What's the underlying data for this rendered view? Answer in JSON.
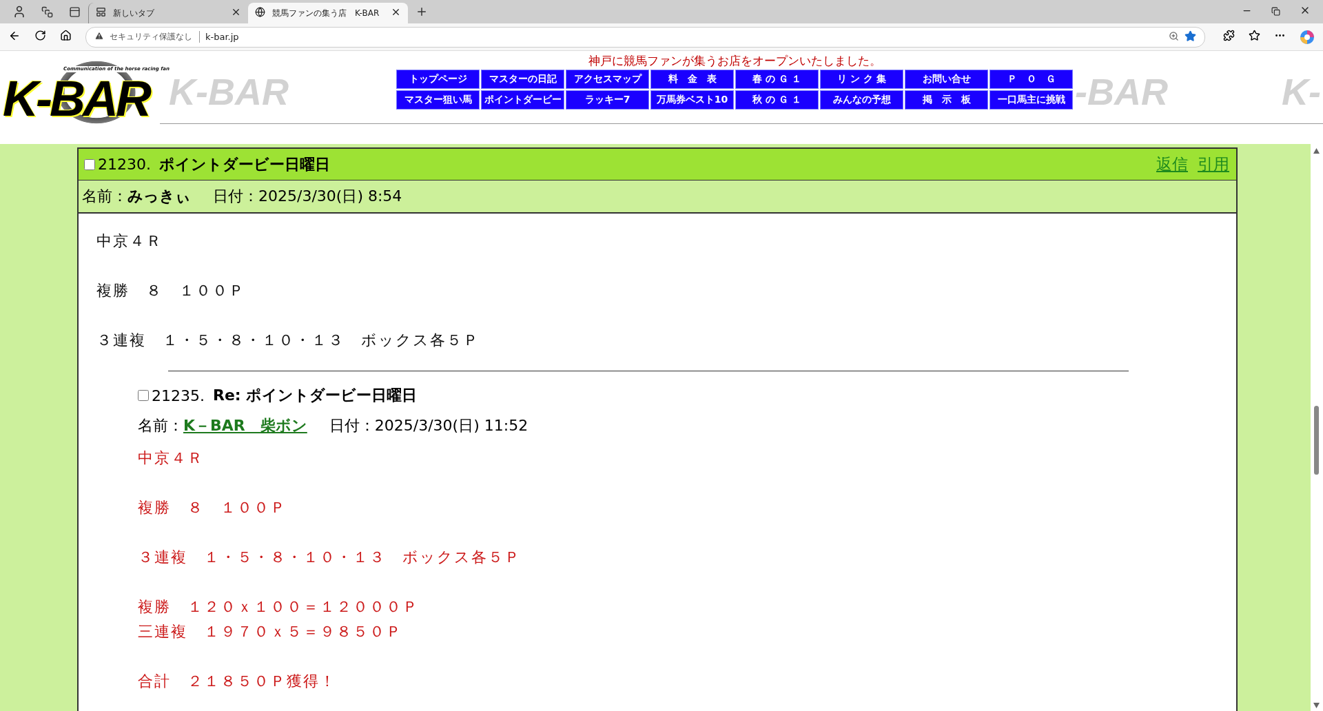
{
  "browser": {
    "tabs": [
      {
        "title": "新しいタブ",
        "selected": false
      },
      {
        "title": "競馬ファンの集う店　K-BAR",
        "selected": true
      }
    ],
    "address": {
      "security": "セキュリティ保護なし",
      "url": "k-bar.jp"
    }
  },
  "header": {
    "logo": {
      "title": "K-BAR",
      "tagline": "Communication of the horse racing fan"
    },
    "background_logos": [
      "K-BAR",
      "-BAR",
      "K-"
    ],
    "announcement": "神戸に競馬ファンが集うお店をオープンいたしました。",
    "nav": [
      [
        "トップページ",
        "マスターの日記",
        "アクセスマップ",
        "料　金　表",
        "春 の Ｇ １",
        "リ ン ク 集",
        "お問い合せ",
        "Ｐ　Ｏ　Ｇ"
      ],
      [
        "マスター狙い馬",
        "ポイントダービー",
        "ラッキー7",
        "万馬券ベスト10",
        "秋 の Ｇ １",
        "みんなの予想",
        "掲　示　板",
        "一口馬主に挑戦"
      ]
    ]
  },
  "post": {
    "checked": false,
    "number": "21230.",
    "title": "ポイントダービー日曜日",
    "actions": [
      "返信",
      "引用"
    ],
    "name_label": "名前：",
    "author": "みっきぃ",
    "date_label": "日付：",
    "date": "2025/3/30(日) 8:54",
    "paragraphs": [
      [
        "中京４Ｒ"
      ],
      [
        "複勝　８　１００Ｐ"
      ],
      [
        "３連複　１・５・８・１０・１３　ボックス各５Ｐ"
      ]
    ],
    "reply": {
      "checked": false,
      "number": "21235.",
      "title": "Re: ポイントダービー日曜日",
      "name_label": "名前：",
      "author_link": "K－BAR　柴ボン",
      "date_label": "日付：",
      "date": "2025/3/30(日) 11:52",
      "paragraphs": [
        [
          "中京４Ｒ"
        ],
        [
          "複勝　８　１００Ｐ"
        ],
        [
          "３連複　１・５・８・１０・１３　ボックス各５Ｐ"
        ],
        [
          "複勝　１２０ｘ１００＝１２０００Ｐ",
          "三連複　１９７０ｘ５＝９８５０Ｐ"
        ],
        [
          "合計　２１８５０Ｐ獲得！"
        ]
      ]
    }
  }
}
